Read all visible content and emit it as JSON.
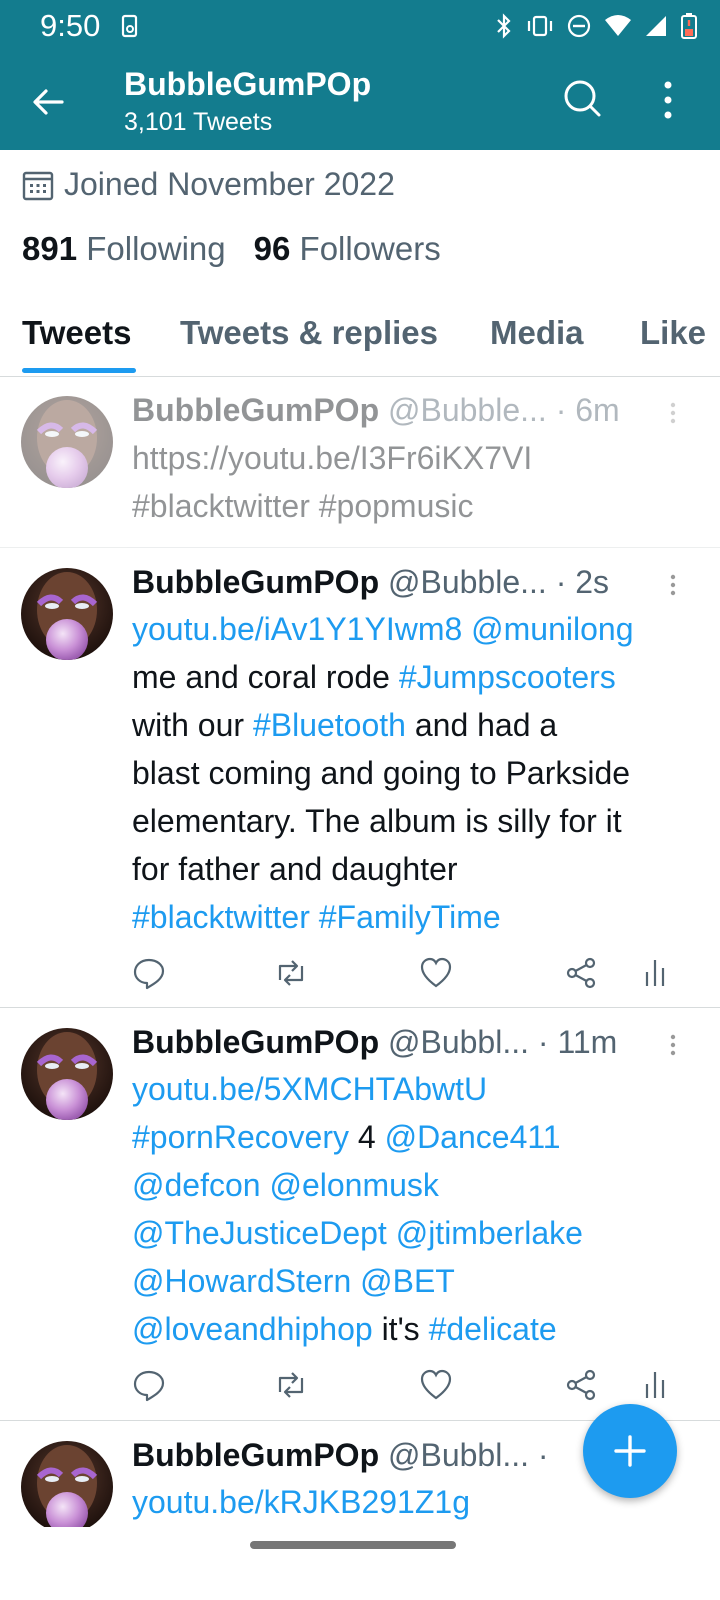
{
  "status_bar": {
    "time": "9:50"
  },
  "header": {
    "title": "BubbleGumPOp",
    "subtitle": "3,101 Tweets"
  },
  "profile": {
    "joined": "Joined November 2022",
    "following_count": "891",
    "following_label": "Following",
    "followers_count": "96",
    "followers_label": "Followers"
  },
  "tabs": [
    {
      "label": "Tweets"
    },
    {
      "label": "Tweets & replies"
    },
    {
      "label": "Media"
    },
    {
      "label": "Like"
    }
  ],
  "tweets": [
    {
      "name": "BubbleGumPOp",
      "handle": "@Bubble...",
      "time": "· 6m",
      "lines": [
        [
          {
            "t": "https://youtu.be/I3Fr6iKX7VI",
            "c": "plain"
          }
        ],
        [
          {
            "t": "#blacktwitter #popmusic",
            "c": "plain"
          }
        ]
      ]
    },
    {
      "name": "BubbleGumPOp",
      "handle": "@Bubble...",
      "time": "· 2s",
      "lines": [
        [
          {
            "t": "youtu.be/iAv1Y1YIwm8",
            "c": "link"
          },
          {
            "t": " ",
            "c": "plain"
          },
          {
            "t": "@munilong",
            "c": "link"
          }
        ],
        [
          {
            "t": "me and coral rode ",
            "c": "plain"
          },
          {
            "t": "#Jumpscooters",
            "c": "link"
          }
        ],
        [
          {
            "t": "with our ",
            "c": "plain"
          },
          {
            "t": "#Bluetooth",
            "c": "link"
          },
          {
            "t": " and had a",
            "c": "plain"
          }
        ],
        [
          {
            "t": "blast coming and going to Parkside",
            "c": "plain"
          }
        ],
        [
          {
            "t": "elementary. The album is silly for it",
            "c": "plain"
          }
        ],
        [
          {
            "t": "for father and daughter",
            "c": "plain"
          }
        ],
        [
          {
            "t": "#blacktwitter",
            "c": "link"
          },
          {
            "t": " ",
            "c": "plain"
          },
          {
            "t": "#FamilyTime",
            "c": "link"
          }
        ]
      ]
    },
    {
      "name": "BubbleGumPOp",
      "handle": "@Bubbl...",
      "time": "· 11m",
      "lines": [
        [
          {
            "t": "youtu.be/5XMCHTAbwtU",
            "c": "link"
          }
        ],
        [
          {
            "t": "#pornRecovery",
            "c": "link"
          },
          {
            "t": " 4 ",
            "c": "plain"
          },
          {
            "t": "@Dance411",
            "c": "link"
          }
        ],
        [
          {
            "t": "@defcon",
            "c": "link"
          },
          {
            "t": " ",
            "c": "plain"
          },
          {
            "t": "@elonmusk",
            "c": "link"
          }
        ],
        [
          {
            "t": "@TheJusticeDept",
            "c": "link"
          },
          {
            "t": " ",
            "c": "plain"
          },
          {
            "t": "@jtimberlake",
            "c": "link"
          }
        ],
        [
          {
            "t": "@HowardStern",
            "c": "link"
          },
          {
            "t": " ",
            "c": "plain"
          },
          {
            "t": "@BET",
            "c": "link"
          }
        ],
        [
          {
            "t": "@loveandhiphop",
            "c": "link"
          },
          {
            "t": " it's ",
            "c": "plain"
          },
          {
            "t": "#delicate",
            "c": "link"
          }
        ]
      ]
    },
    {
      "name": "BubbleGumPOp",
      "handle": "@Bubbl...",
      "time": "·",
      "lines": [
        [
          {
            "t": "youtu.be/kRJKB291Z1g",
            "c": "link"
          }
        ]
      ]
    }
  ],
  "colors": {
    "header_bg": "#137c8e",
    "link": "#1d9bf0",
    "muted": "#536471"
  }
}
